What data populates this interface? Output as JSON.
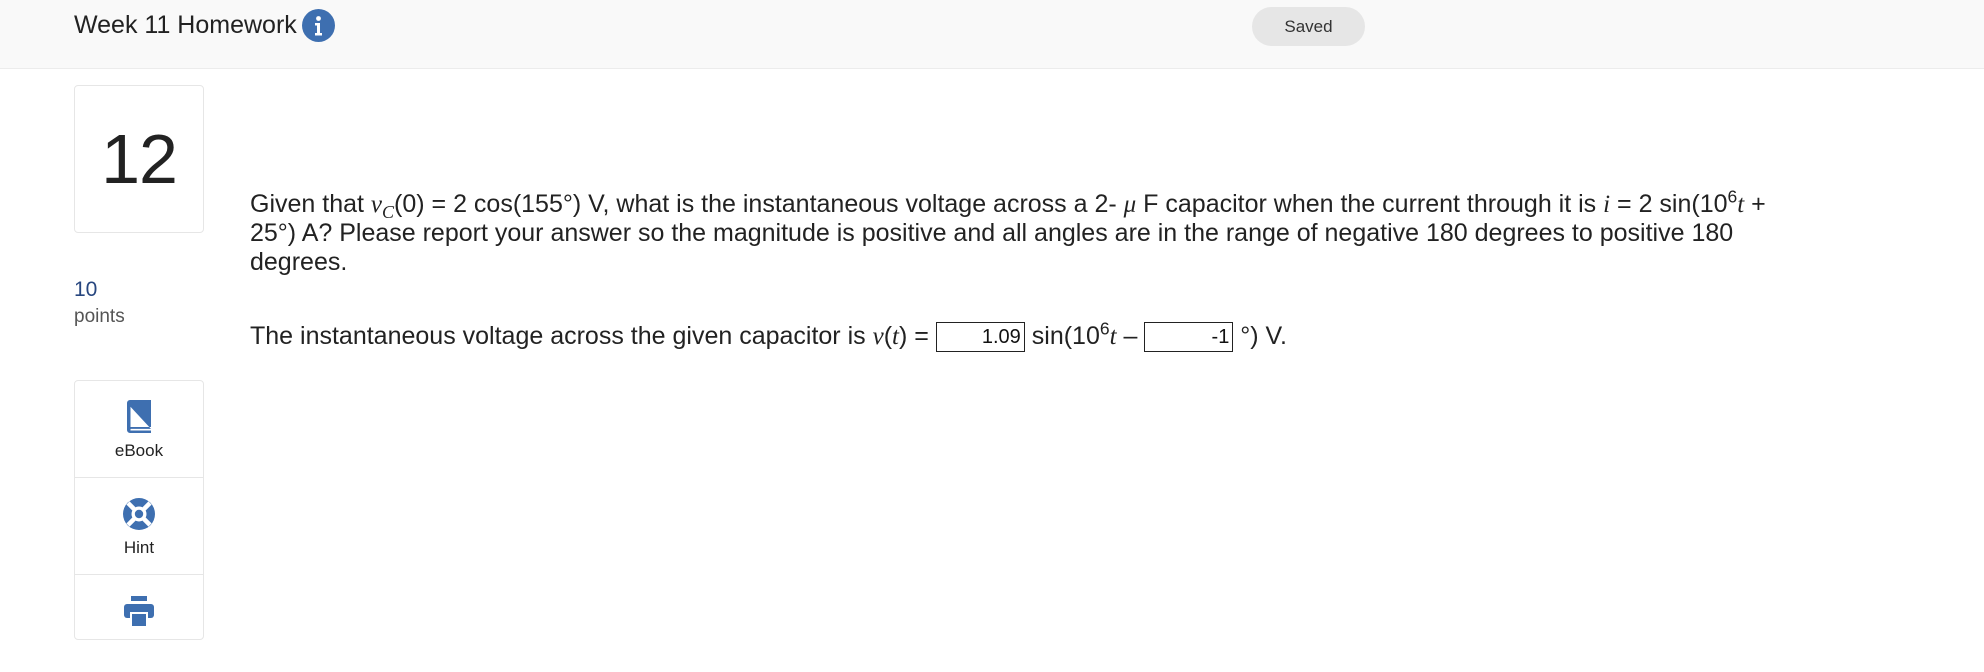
{
  "header": {
    "title": "Week 11 Homework",
    "status": "Saved",
    "info_icon": "info-icon",
    "accent_color": "#3e6fb0"
  },
  "question": {
    "number": "12",
    "points": "10",
    "points_label": "points",
    "prompt": {
      "p1": "Given that ",
      "v": "v",
      "c": "C",
      "p2": "(0) = 2 cos(155°) V, what is the instantaneous voltage across a 2- ",
      "mu": "μ",
      "p3": " F capacitor when the current through it is ",
      "i": "i",
      "p4": " = 2 sin(10",
      "exp": "6",
      "t": "t",
      "p5": " + 25°) A? Please report your answer so the magnitude is positive and all angles are in the range of negative 180 degrees to positive 180 degrees."
    },
    "answer": {
      "lead": "The instantaneous voltage across the given capacitor is ",
      "v": "v",
      "t": "t",
      "eq": ") = ",
      "value1": "1.09",
      "mid": " sin(10",
      "exp": "6",
      "t2": "t",
      "minus": " – ",
      "value2": "-1",
      "tail": " °) V."
    }
  },
  "tools": [
    {
      "label": "eBook",
      "icon": "book-icon"
    },
    {
      "label": "Hint",
      "icon": "lifebuoy-icon"
    },
    {
      "label": "",
      "icon": "print-icon"
    }
  ]
}
